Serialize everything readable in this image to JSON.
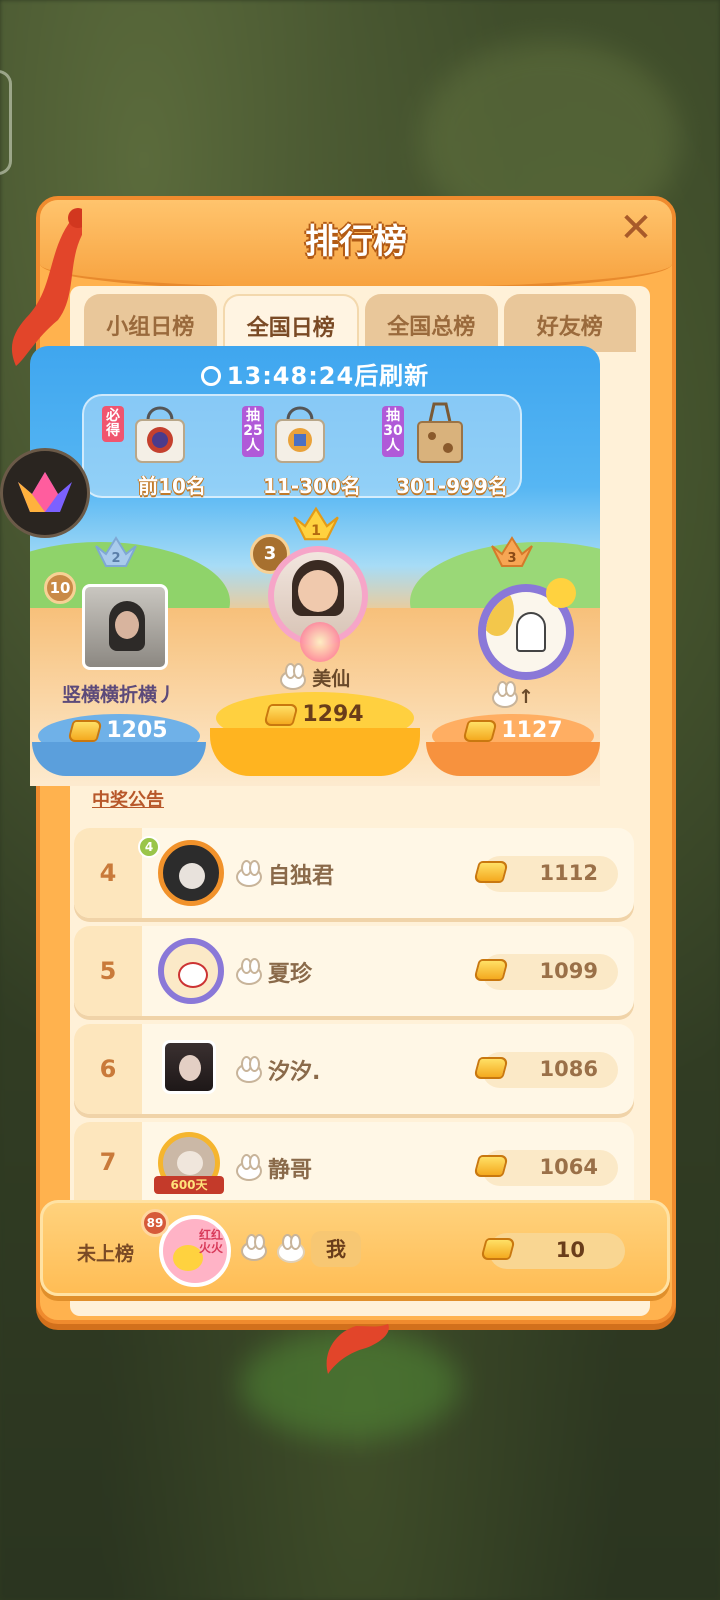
{
  "title": "排行榜",
  "tabs": [
    {
      "label": "小组日榜",
      "active": false
    },
    {
      "label": "全国日榜",
      "active": true
    },
    {
      "label": "全国总榜",
      "active": false
    },
    {
      "label": "好友榜",
      "active": false
    }
  ],
  "refresh_timer": "13:48:24后刷新",
  "rewards": [
    {
      "tag": "必得",
      "range": "前10名",
      "tag_color": "#f0556f"
    },
    {
      "tag": "抽25人",
      "range": "11-300名",
      "tag_color": "#b05ad8"
    },
    {
      "tag": "抽30人",
      "range": "301-999名",
      "tag_color": "#b05ad8"
    }
  ],
  "podium": {
    "first": {
      "crown_rank": "1",
      "badge": "3",
      "name": "美仙",
      "score": "1294"
    },
    "second": {
      "crown_rank": "2",
      "badge": "10",
      "name": "竖横横折横丿",
      "score": "1205"
    },
    "third": {
      "crown_rank": "3",
      "name": "↑",
      "score": "1127"
    }
  },
  "announcement": "中奖公告",
  "list": [
    {
      "rank": "4",
      "name": "自独君",
      "score": "1112",
      "level": "4"
    },
    {
      "rank": "5",
      "name": "夏珍",
      "score": "1099"
    },
    {
      "rank": "6",
      "name": "汐汐.",
      "score": "1086"
    },
    {
      "rank": "7",
      "name": "静哥",
      "score": "1064",
      "frame_text": "600天"
    }
  ],
  "me": {
    "status": "未上榜",
    "name": "我",
    "score": "10",
    "level": "89",
    "avatar_text": "红红火火"
  },
  "icons": {
    "close": "close-icon",
    "coin": "gold-bar-icon",
    "clock": "clock-icon"
  }
}
